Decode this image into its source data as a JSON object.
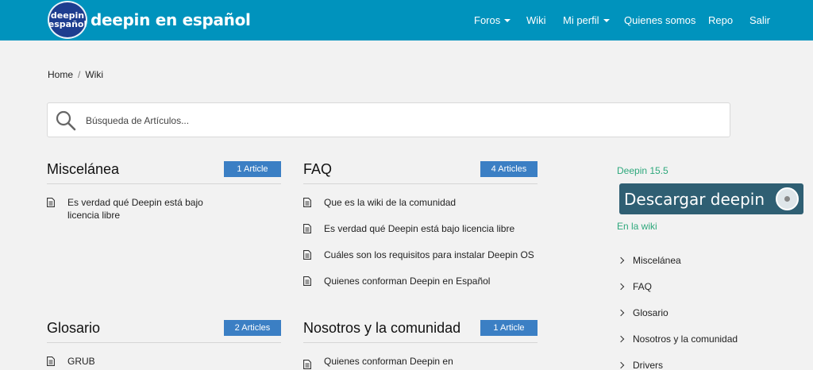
{
  "brand": {
    "badge_line1": "deepin",
    "badge_line2": "español",
    "name": "deepin en español"
  },
  "nav": {
    "foros": "Foros",
    "wiki": "Wiki",
    "perfil": "Mi perfil",
    "quienes": "Quienes somos",
    "repo": "Repo",
    "salir": "Salir"
  },
  "breadcrumb": {
    "home": "Home",
    "separator": "/",
    "current": "Wiki"
  },
  "search": {
    "placeholder": "Búsqueda de Artículos...",
    "value": ""
  },
  "sections": [
    {
      "title": "Miscelánea",
      "badge": "1 Article",
      "articles": [
        "Es verdad qué Deepin está bajo licencia libre"
      ]
    },
    {
      "title": "FAQ",
      "badge": "4 Articles",
      "articles": [
        "Que es la wiki de la comunidad",
        "Es verdad qué Deepin está bajo licencia libre",
        "Cuáles son los requisitos para instalar Deepin OS",
        "Quienes conforman Deepin en Español"
      ]
    },
    {
      "title": "Glosario",
      "badge": "2 Articles",
      "articles": [
        "GRUB"
      ]
    },
    {
      "title": "Nosotros y la comunidad",
      "badge": "1 Article",
      "articles": [
        "Quienes conforman Deepin en"
      ]
    }
  ],
  "sidebar": {
    "version_heading": "Deepin 15.5",
    "download_label": "Descargar deepin",
    "wiki_heading": "En la wiki",
    "links": [
      "Miscelánea",
      "FAQ",
      "Glosario",
      "Nosotros y la comunidad",
      "Drivers"
    ]
  },
  "colors": {
    "topbar": "#0093bd",
    "badge": "#3b7fc4",
    "sidebar_heading": "#2ea87c",
    "download": "#2f5f73"
  },
  "icons": {
    "search": "magnifier-icon",
    "article": "document-icon",
    "dropdown": "caret-down-icon",
    "link": "chevron-right-icon",
    "disc": "disc-icon"
  }
}
